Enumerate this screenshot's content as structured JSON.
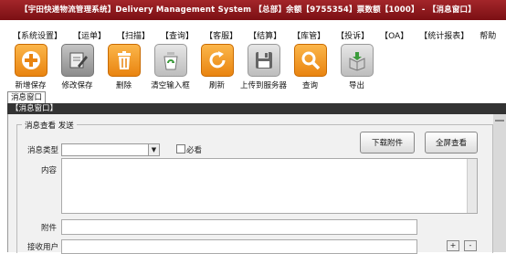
{
  "window": {
    "title": "【宇田快递物流管理系统】Delivery Management System 【总部】余额【9755354】票数额【1000】 - 【消息窗口】"
  },
  "menu": {
    "items": [
      "【系统设置】",
      "【运单】",
      "【扫描】",
      "【查询】",
      "【客服】",
      "【结算】",
      "【库管】",
      "【投诉】",
      "【OA】",
      "【统计报表】",
      "帮助"
    ]
  },
  "toolbar": {
    "buttons": [
      {
        "label": "新增保存",
        "icon": "add-circle-icon"
      },
      {
        "label": "修改保存",
        "icon": "edit-pencil-icon"
      },
      {
        "label": "删除",
        "icon": "trash-icon"
      },
      {
        "label": "清空输入框",
        "icon": "recycle-icon"
      },
      {
        "label": "刷新",
        "icon": "refresh-icon"
      },
      {
        "label": "上传到服务器",
        "icon": "floppy-disk-icon"
      },
      {
        "label": "查询",
        "icon": "magnifier-icon"
      },
      {
        "label": "导出",
        "icon": "export-box-icon"
      }
    ]
  },
  "tabs": {
    "active": "消息窗口"
  },
  "panel": {
    "header": "【消息窗口】",
    "legend": "消息查看 发送",
    "message_type_label": "消息类型",
    "message_type_value": "",
    "checkbox_label": "必看",
    "content_label": "内容",
    "attachment_label": "附件",
    "recipient_label": "接收用户",
    "download_button": "下载附件",
    "fullscreen_button": "全屏查看",
    "add_recipient": "+",
    "remove_recipient": "-"
  },
  "colors": {
    "titlebar": "#8f1a1e",
    "tool_orange": "#f39c1f",
    "tool_gray": "#9a9a9a"
  }
}
